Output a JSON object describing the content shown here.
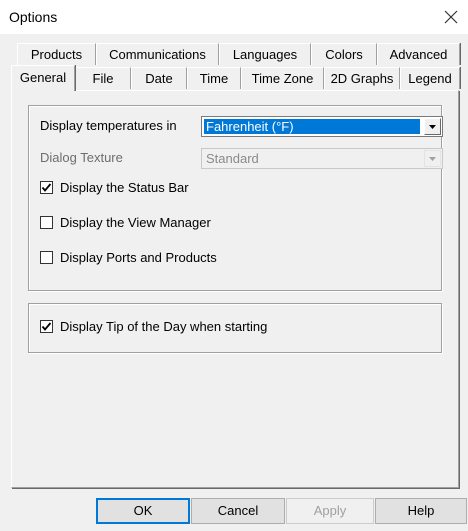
{
  "window": {
    "title": "Options"
  },
  "tabs_back": [
    {
      "label": "Products"
    },
    {
      "label": "Communications"
    },
    {
      "label": "Languages"
    },
    {
      "label": "Colors"
    },
    {
      "label": "Advanced"
    }
  ],
  "tabs_front": [
    {
      "label": "General",
      "active": true
    },
    {
      "label": "File"
    },
    {
      "label": "Date"
    },
    {
      "label": "Time"
    },
    {
      "label": "Time Zone"
    },
    {
      "label": "2D Graphs"
    },
    {
      "label": "Legend"
    }
  ],
  "general": {
    "temperature_label": "Display temperatures in",
    "temperature_value": "Fahrenheit (°F)",
    "texture_label": "Dialog Texture",
    "texture_value": "Standard",
    "checks": [
      {
        "label": "Display the Status Bar",
        "checked": true
      },
      {
        "label": "Display the View Manager",
        "checked": false
      },
      {
        "label": "Display Ports and Products",
        "checked": false
      }
    ],
    "tip_check": {
      "label": "Display Tip of the Day when starting",
      "checked": true
    }
  },
  "buttons": {
    "ok": "OK",
    "cancel": "Cancel",
    "apply": "Apply",
    "help": "Help"
  }
}
